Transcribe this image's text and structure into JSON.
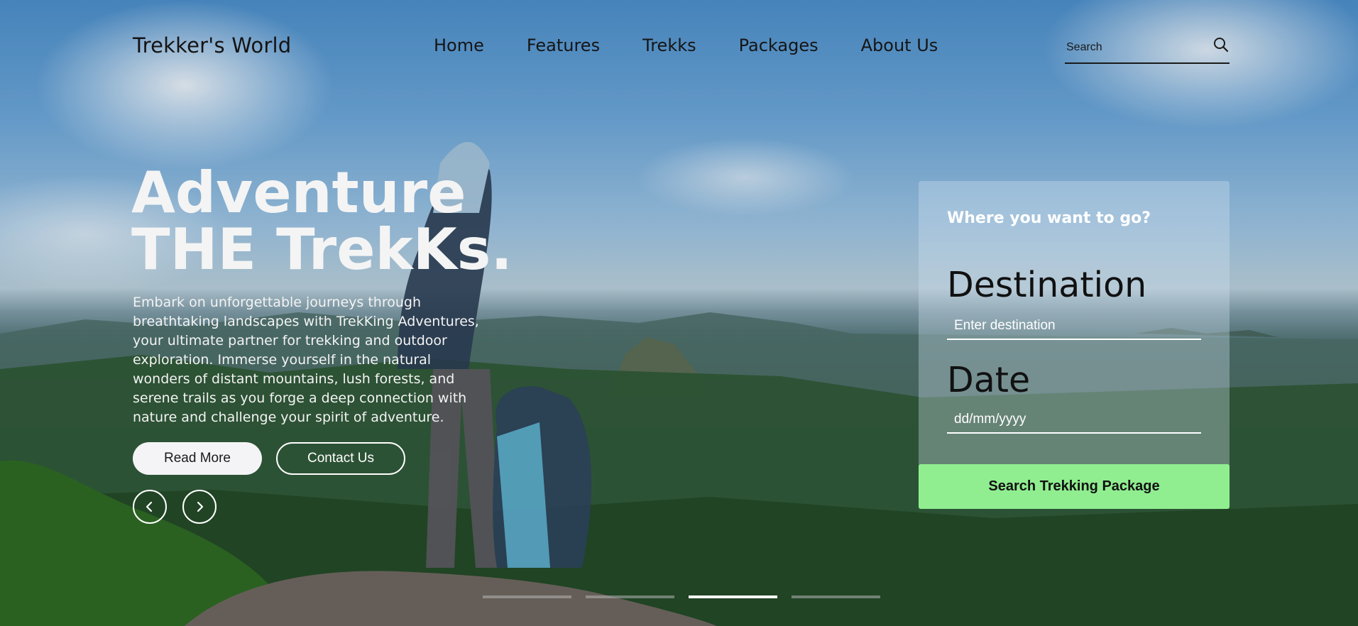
{
  "header": {
    "logo": "Trekker's World",
    "nav": [
      {
        "label": "Home"
      },
      {
        "label": "Features"
      },
      {
        "label": "Trekks"
      },
      {
        "label": "Packages"
      },
      {
        "label": "About Us"
      }
    ],
    "search": {
      "placeholder": "Search",
      "icon": "search-icon"
    }
  },
  "hero": {
    "headline_line1": "Adventure",
    "headline_line2": "THE TrekKs.",
    "intro": "Embark on unforgettable journeys through breathtaking landscapes with TrekKing Adventures, your ultimate partner for trekking and outdoor exploration. Immerse yourself in the natural wonders of distant mountains, lush forests, and serene trails as you forge a deep connection with nature and challenge your spirit of adventure.",
    "read_more_label": "Read More",
    "contact_label": "Contact Us",
    "prev_icon": "chevron-left-icon",
    "next_icon": "chevron-right-icon"
  },
  "booking": {
    "title": "Where you want to go?",
    "destination_label": "Destination",
    "destination_placeholder": "Enter destination",
    "date_label": "Date",
    "date_placeholder": "dd/mm/yyyy",
    "submit_label": "Search Trekking Package"
  },
  "slider": {
    "count": 4,
    "active_index": 2
  },
  "colors": {
    "accent": "#90ee90",
    "text_dark": "#141414",
    "text_light": "#ffffff"
  }
}
